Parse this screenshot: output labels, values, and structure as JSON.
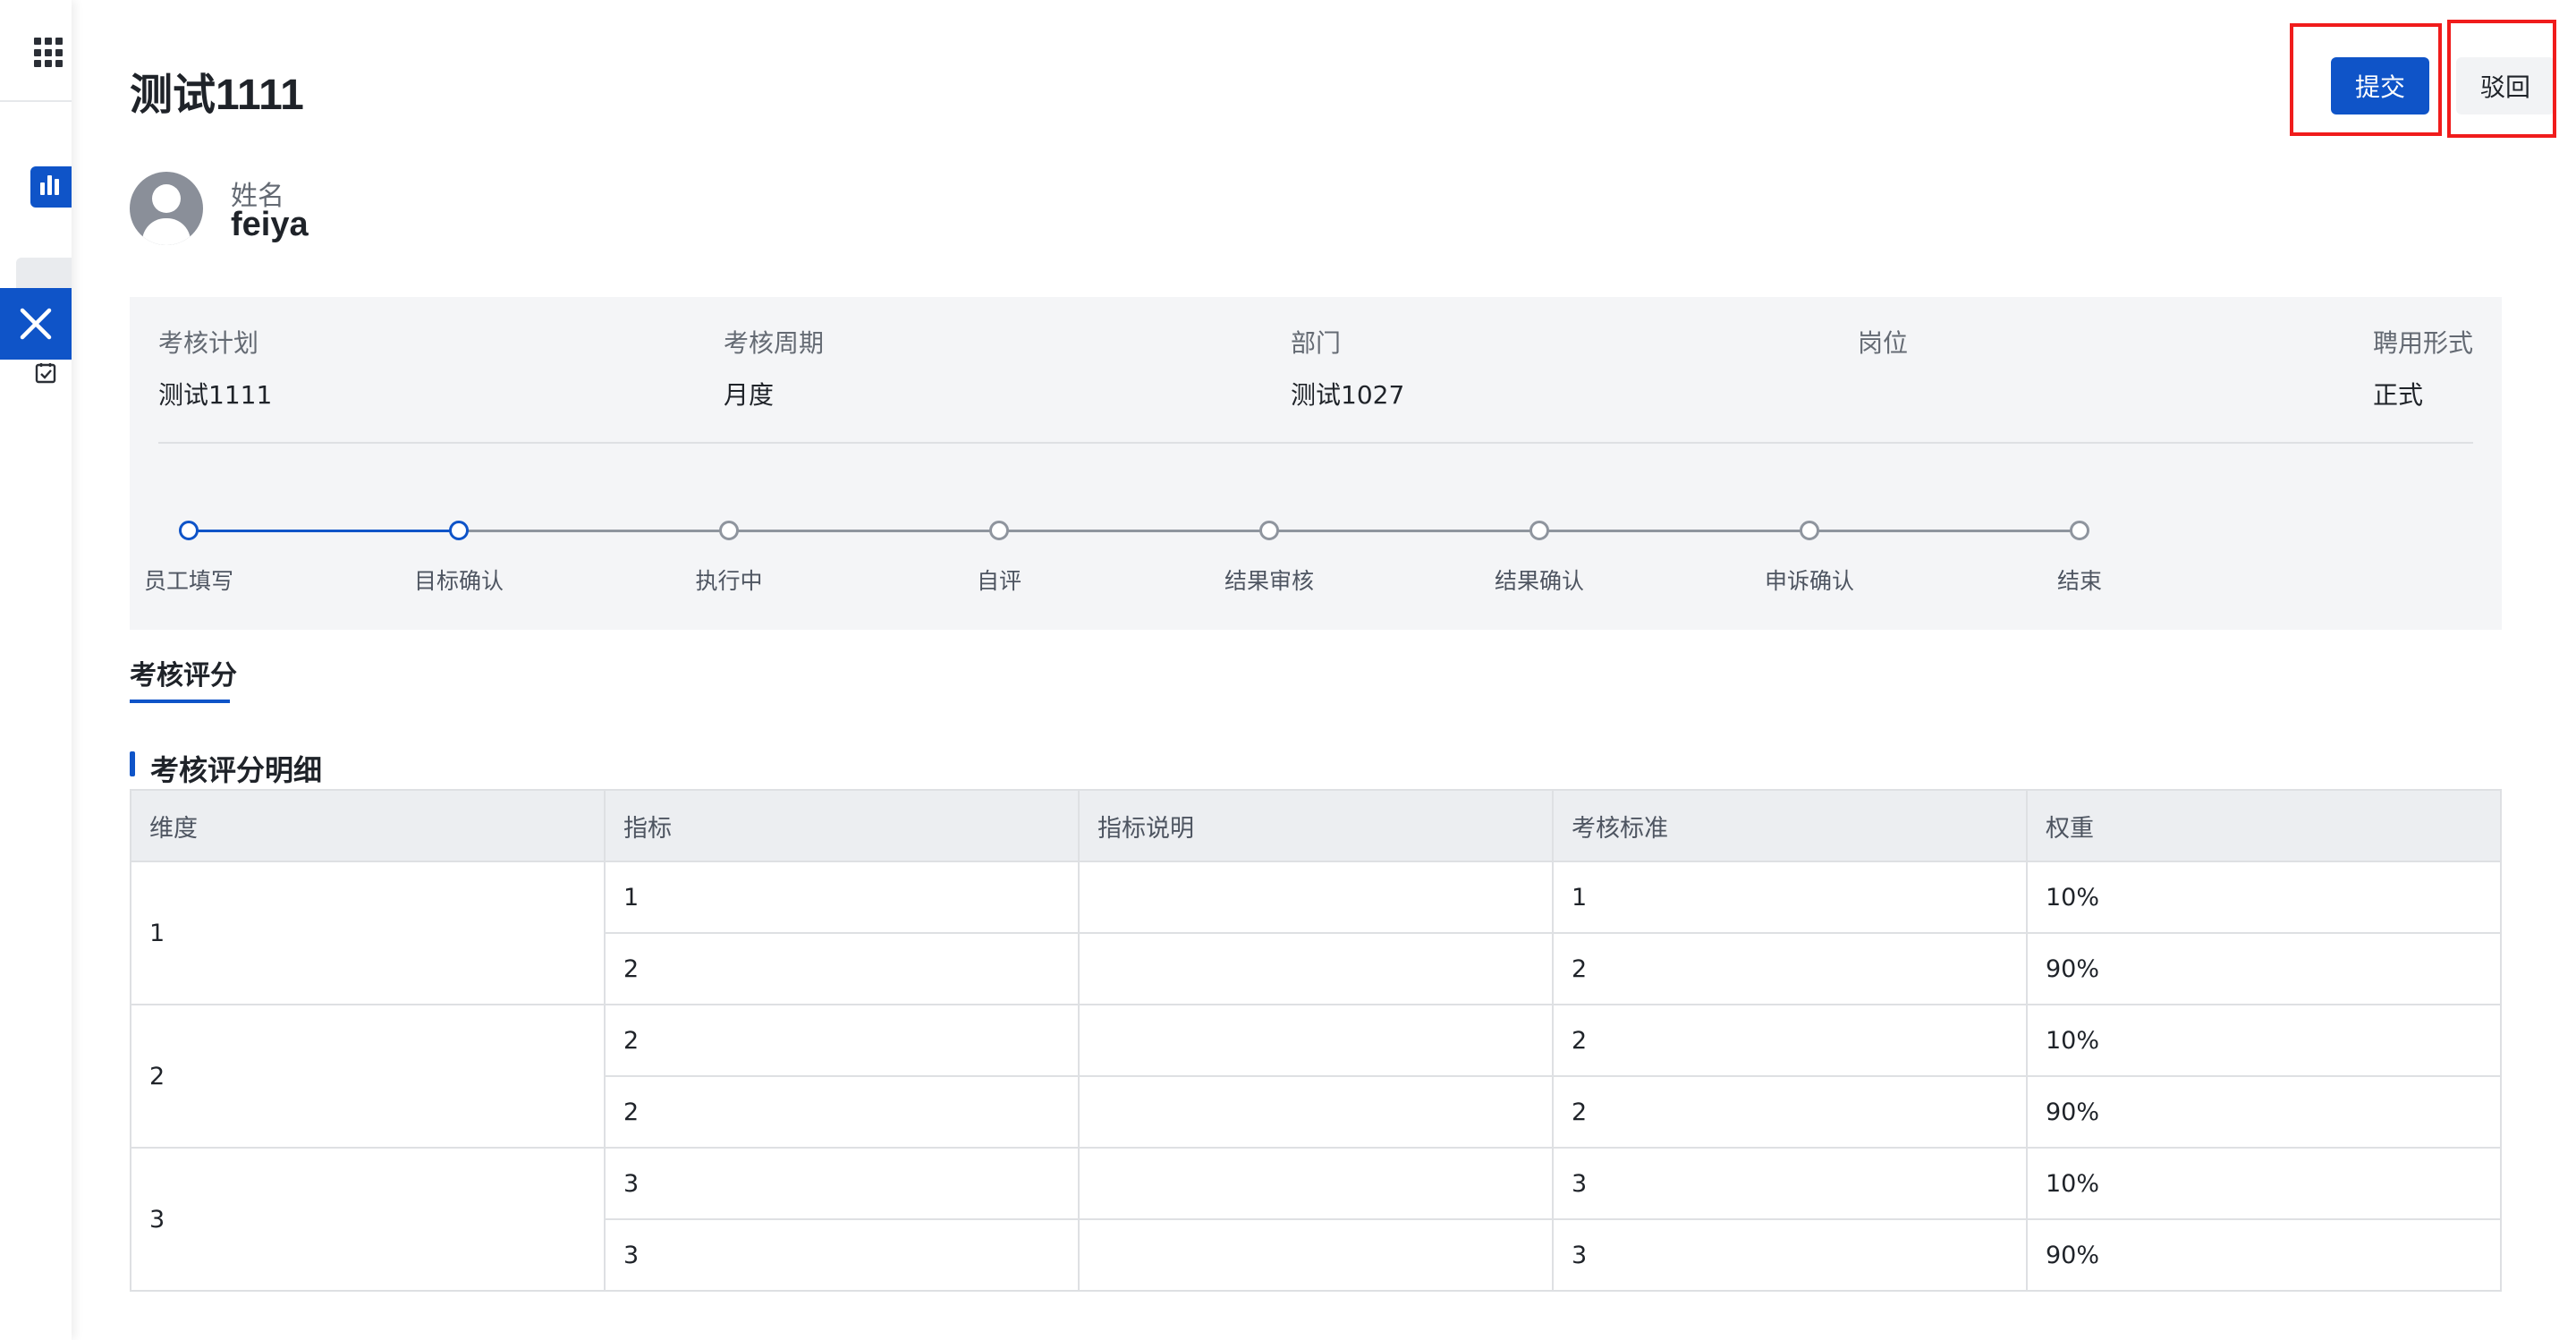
{
  "page": {
    "title": "测试1111"
  },
  "actions": {
    "submit_label": "提交",
    "reject_label": "驳回"
  },
  "employee": {
    "name_label": "姓名",
    "name": "feiya"
  },
  "info": [
    {
      "label": "考核计划",
      "value": "测试1111"
    },
    {
      "label": "考核周期",
      "value": "月度"
    },
    {
      "label": "部门",
      "value": "测试1027"
    },
    {
      "label": "岗位",
      "value": ""
    },
    {
      "label": "聘用形式",
      "value": "正式"
    }
  ],
  "steps": {
    "current_index": 1,
    "items": [
      "员工填写",
      "目标确认",
      "执行中",
      "自评",
      "结果审核",
      "结果确认",
      "申诉确认",
      "结束"
    ]
  },
  "tabs": [
    {
      "label": "考核评分",
      "active": true
    }
  ],
  "section": {
    "title": "考核评分明细"
  },
  "table": {
    "headers": [
      "维度",
      "指标",
      "指标说明",
      "考核标准",
      "权重"
    ],
    "groups": [
      {
        "dimension": "1",
        "rows": [
          {
            "indicator": "1",
            "description": "",
            "standard": "1",
            "weight": "10%"
          },
          {
            "indicator": "2",
            "description": "",
            "standard": "2",
            "weight": "90%"
          }
        ]
      },
      {
        "dimension": "2",
        "rows": [
          {
            "indicator": "2",
            "description": "",
            "standard": "2",
            "weight": "10%"
          },
          {
            "indicator": "2",
            "description": "",
            "standard": "2",
            "weight": "90%"
          }
        ]
      },
      {
        "dimension": "3",
        "rows": [
          {
            "indicator": "3",
            "description": "",
            "standard": "3",
            "weight": "10%"
          },
          {
            "indicator": "3",
            "description": "",
            "standard": "3",
            "weight": "90%"
          }
        ]
      }
    ]
  },
  "colors": {
    "primary": "#0f54c8",
    "highlight": "#f01c1c"
  },
  "icons": {
    "apps": "apps-grid-icon",
    "chart": "bar-chart-icon",
    "close": "close-icon",
    "checkbox": "checkbox-icon"
  }
}
